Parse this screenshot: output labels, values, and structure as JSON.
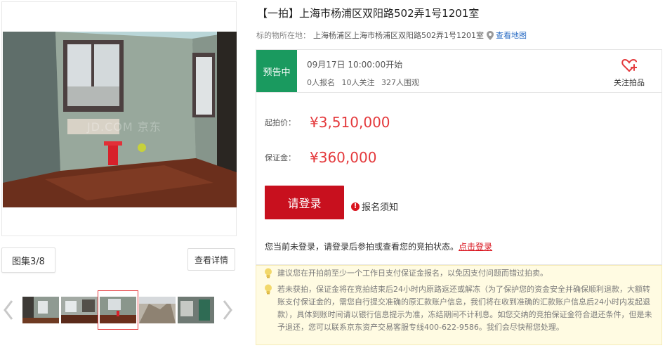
{
  "gallery": {
    "counter": "图集3/8",
    "details_label": "查看详情",
    "watermark": "JD.COM 京东"
  },
  "lot": {
    "title": "【一拍】上海市杨浦区双阳路502弄1号1201室",
    "location_label": "标的物所在地：",
    "location_value": "上海杨浦区上海市杨浦区双阳路502弄1号1201室",
    "map_link": "查看地图"
  },
  "status": {
    "badge": "预告中",
    "start_time": "09月17日 10:00:00开始",
    "registered": "0人报名",
    "followers": "10人关注",
    "views": "327人围观",
    "follow_label": "关注拍品"
  },
  "pricing": {
    "start_label": "起拍价：",
    "start_value": "¥3,510,000",
    "deposit_label": "保证金：",
    "deposit_value": "¥360,000"
  },
  "actions": {
    "login_button": "请登录",
    "notice_label": "报名须知",
    "login_prompt": "您当前未登录，请登录后参拍或查看您的竞拍状态。",
    "login_link": "点击登录"
  },
  "tips": [
    "建议您在开拍前至少一个工作日支付保证金报名，以免因支付问题而错过拍卖。",
    "若未获拍，保证金将在竞拍结束后24小时内原路返还或解冻（为了保护您的资金安全并确保顺利退款，大额转账支付保证金的，需您自行提交准确的原汇款账户信息，我们将在收到准确的汇款账户信息后24小时内发起退款），具体到账时间请以银行信息提示为准，冻结期间不计利息。如您交纳的竞拍保证金符合退还条件，但是未予退还，您可以联系京东资产交易客服专线400-622-9586。我们会尽快帮您处理。"
  ],
  "colors": {
    "price_red": "#e4393c",
    "status_green": "#1a9a5f",
    "button_red": "#c8101e",
    "link_blue": "#2a6cc4",
    "tip_bg": "#fffbe2"
  }
}
